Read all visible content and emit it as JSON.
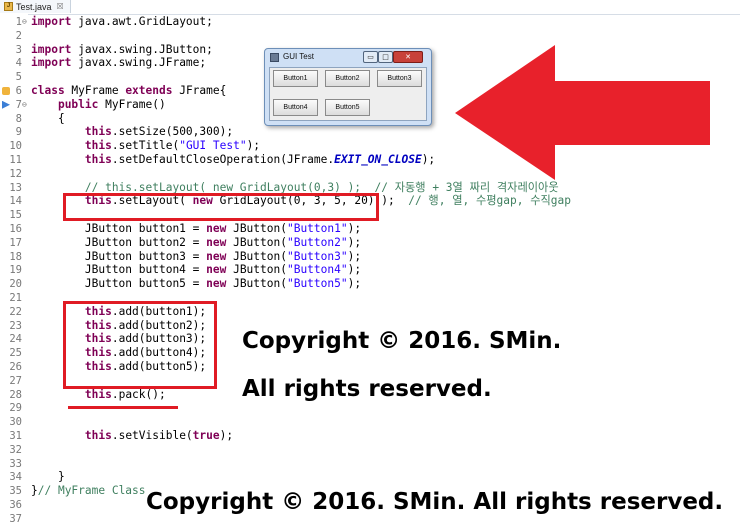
{
  "editor": {
    "tab_title": "Test.java",
    "tab_close": "☒",
    "lines": [
      {
        "n": "1",
        "html": "<span class=\"kw\">import</span> java.awt.GridLayout;"
      },
      {
        "n": "2",
        "html": ""
      },
      {
        "n": "3",
        "html": "<span class=\"kw\">import</span> javax.swing.JButton;"
      },
      {
        "n": "4",
        "html": "<span class=\"kw\">import</span> javax.swing.JFrame;"
      },
      {
        "n": "5",
        "html": ""
      },
      {
        "n": "6",
        "html": "<span class=\"kw\">class</span> MyFrame <span class=\"kw\">extends</span> JFrame{"
      },
      {
        "n": "7",
        "html": "    <span class=\"kw\">public</span> MyFrame()"
      },
      {
        "n": "8",
        "html": "    {"
      },
      {
        "n": "9",
        "html": "        <span class=\"kw\">this</span>.setSize(500,300);"
      },
      {
        "n": "10",
        "html": "        <span class=\"kw\">this</span>.setTitle(<span class=\"str\">\"GUI Test\"</span>);"
      },
      {
        "n": "11",
        "html": "        <span class=\"kw\">this</span>.setDefaultCloseOperation(JFrame.<span class=\"fld\">EXIT_ON_CLOSE</span>);"
      },
      {
        "n": "12",
        "html": ""
      },
      {
        "n": "13",
        "html": "        <span class=\"cmt\">// this.setLayout( new GridLayout(0,3) );  // 자동행 + 3열 짜리 격자레이아웃</span>"
      },
      {
        "n": "14",
        "html": "        <span class=\"kw\">this</span>.setLayout( <span class=\"kw\">new</span> GridLayout(0, 3, 5, 20) );  <span class=\"cmt\">// 행, 열, 수평gap, 수직gap</span>"
      },
      {
        "n": "15",
        "html": ""
      },
      {
        "n": "16",
        "html": "        JButton button1 = <span class=\"kw\">new</span> JButton(<span class=\"str\">\"Button1\"</span>);"
      },
      {
        "n": "17",
        "html": "        JButton button2 = <span class=\"kw\">new</span> JButton(<span class=\"str\">\"Button2\"</span>);"
      },
      {
        "n": "18",
        "html": "        JButton button3 = <span class=\"kw\">new</span> JButton(<span class=\"str\">\"Button3\"</span>);"
      },
      {
        "n": "19",
        "html": "        JButton button4 = <span class=\"kw\">new</span> JButton(<span class=\"str\">\"Button4\"</span>);"
      },
      {
        "n": "20",
        "html": "        JButton button5 = <span class=\"kw\">new</span> JButton(<span class=\"str\">\"Button5\"</span>);"
      },
      {
        "n": "21",
        "html": ""
      },
      {
        "n": "22",
        "html": "        <span class=\"kw\">this</span>.add(button1);"
      },
      {
        "n": "23",
        "html": "        <span class=\"kw\">this</span>.add(button2);"
      },
      {
        "n": "24",
        "html": "        <span class=\"kw\">this</span>.add(button3);"
      },
      {
        "n": "25",
        "html": "        <span class=\"kw\">this</span>.add(button4);"
      },
      {
        "n": "26",
        "html": "        <span class=\"kw\">this</span>.add(button5);"
      },
      {
        "n": "27",
        "html": ""
      },
      {
        "n": "28",
        "html": "        <span class=\"kw\">this</span>.pack();"
      },
      {
        "n": "29",
        "html": ""
      },
      {
        "n": "30",
        "html": ""
      },
      {
        "n": "31",
        "html": "        <span class=\"kw\">this</span>.setVisible(<span class=\"kw\">true</span>);"
      },
      {
        "n": "32",
        "html": ""
      },
      {
        "n": "33",
        "html": ""
      },
      {
        "n": "34",
        "html": "    }"
      },
      {
        "n": "35",
        "html": "}<span class=\"cmt\">// MyFrame Class</span>"
      },
      {
        "n": "36",
        "html": ""
      },
      {
        "n": "37",
        "html": ""
      }
    ]
  },
  "gui_window": {
    "title": "GUI Test",
    "buttons": [
      "Button1",
      "Button2",
      "Button3",
      "Button4",
      "Button5"
    ],
    "minimize": "▭",
    "maximize": "□",
    "close": "✕"
  },
  "watermark": {
    "line1": "Copyright © 2016. SMin.",
    "line2": "All rights reserved.",
    "footer": "Copyright © 2016. SMin. All rights reserved."
  },
  "colors": {
    "highlight": "#e01b24",
    "keyword": "#7f0055",
    "string": "#2a00ff",
    "comment": "#3f7f5f"
  }
}
